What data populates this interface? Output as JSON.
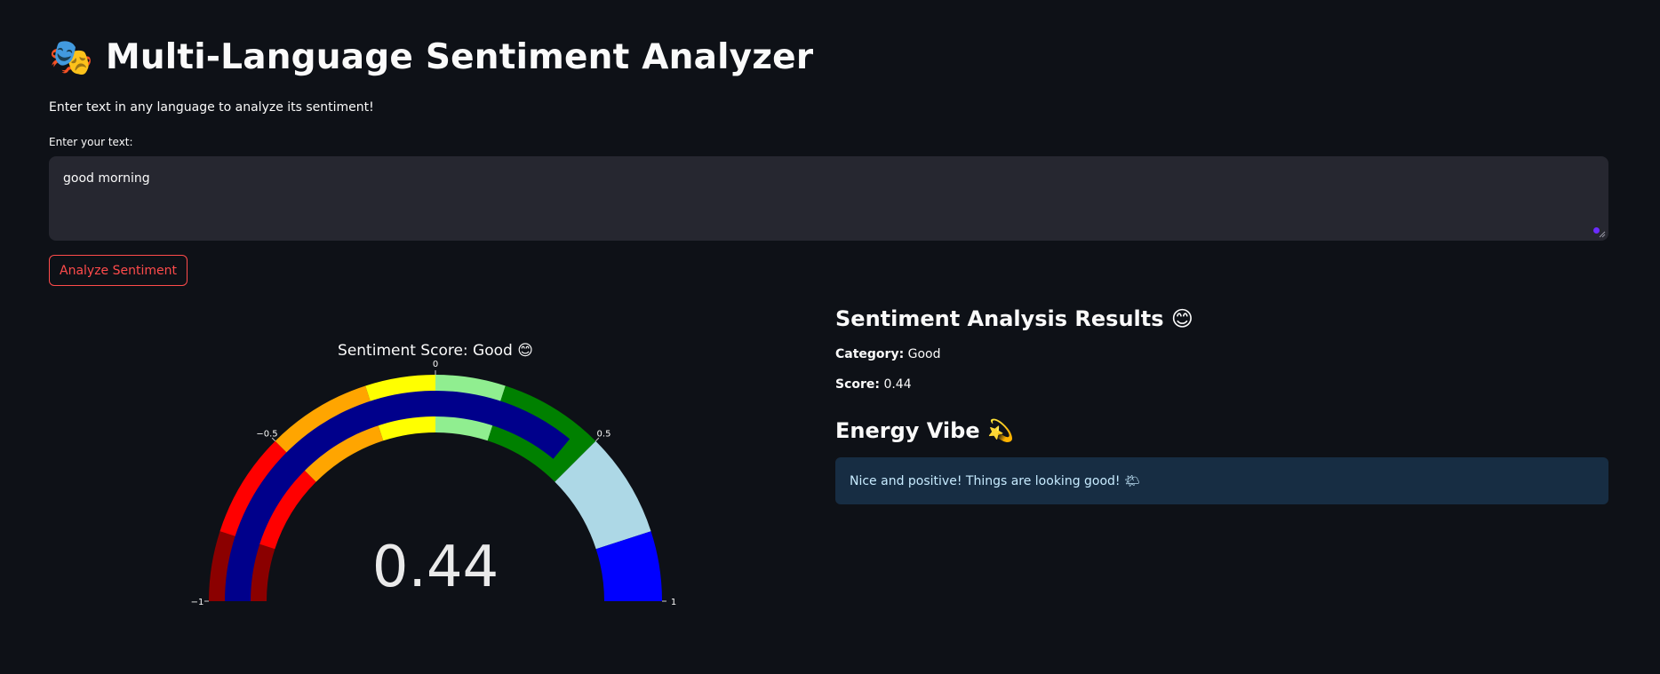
{
  "header": {
    "emoji": "🎭",
    "title": "Multi-Language Sentiment Analyzer",
    "subtitle": "Enter text in any language to analyze its sentiment!"
  },
  "input": {
    "label": "Enter your text:",
    "value": "good morning"
  },
  "button": {
    "label": "Analyze Sentiment"
  },
  "gauge": {
    "title": "Sentiment Score: Good 😊",
    "value": 0.44,
    "value_label": "0.44",
    "range": [
      -1,
      1
    ],
    "ticks": [
      {
        "value": -1,
        "label": "−1"
      },
      {
        "value": -0.5,
        "label": "−0.5"
      },
      {
        "value": 0,
        "label": "0"
      },
      {
        "value": 0.5,
        "label": "0.5"
      },
      {
        "value": 1,
        "label": "1"
      }
    ],
    "bar_color": "#00008b",
    "steps": [
      {
        "from": -1,
        "to": -0.8,
        "color": "#8b0000"
      },
      {
        "from": -0.8,
        "to": -0.5,
        "color": "#ff0000"
      },
      {
        "from": -0.5,
        "to": -0.2,
        "color": "#ffa500"
      },
      {
        "from": -0.2,
        "to": 0,
        "color": "#ffff00"
      },
      {
        "from": 0,
        "to": 0.2,
        "color": "#90ee90"
      },
      {
        "from": 0.2,
        "to": 0.5,
        "color": "#008000"
      },
      {
        "from": 0.5,
        "to": 0.8,
        "color": "#add8e6"
      },
      {
        "from": 0.8,
        "to": 1,
        "color": "#0000ff"
      }
    ]
  },
  "results": {
    "heading": "Sentiment Analysis Results 😊",
    "category_label": "Category:",
    "category_value": "Good",
    "score_label": "Score:",
    "score_value": "0.44",
    "energy_heading": "Energy Vibe 💫",
    "energy_message": "Nice and positive! Things are looking good! 🌤"
  },
  "colors": {
    "background": "#0e1117",
    "input_background": "#262730",
    "accent": "#ff4b4b",
    "info_background": "#172d43",
    "info_text": "#c7ebff"
  }
}
